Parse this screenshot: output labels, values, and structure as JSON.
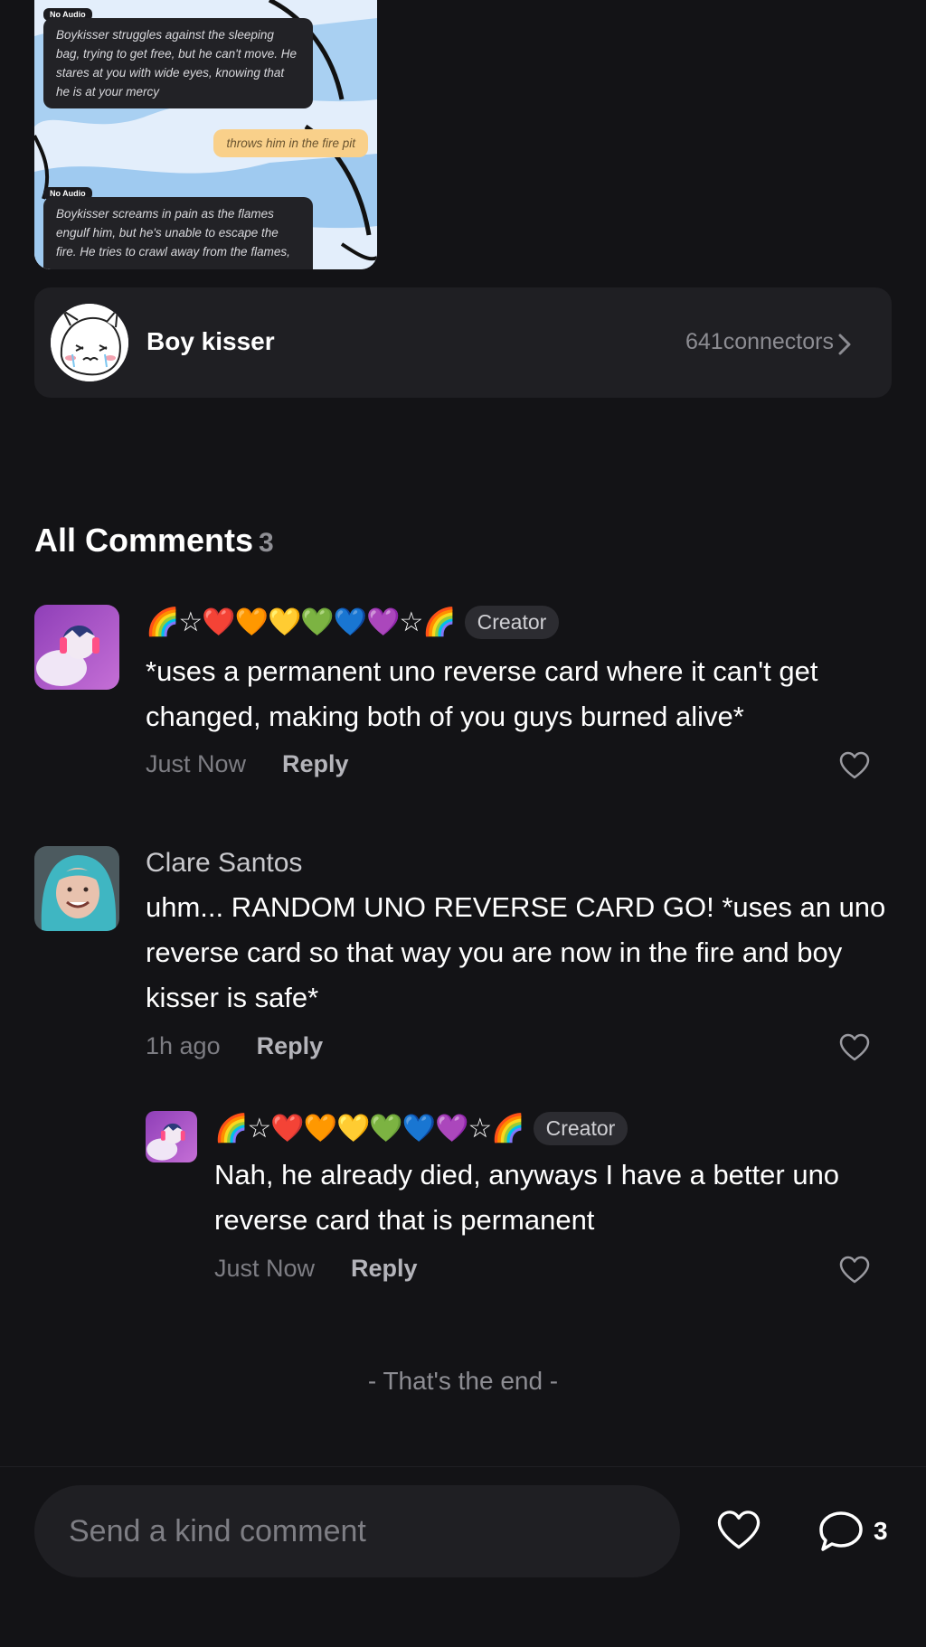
{
  "preview": {
    "messages": [
      {
        "tag": "No Audio",
        "text": "Boykisser struggles against the sleeping bag, trying to get free, but he can't move. He stares at you with wide eyes, knowing that he is at your mercy"
      },
      {
        "user_text": "throws him in the fire pit"
      },
      {
        "tag": "No Audio",
        "text": "Boykisser screams in pain as the flames engulf him, but he's unable to escape the fire. He tries to crawl away from the flames,"
      }
    ]
  },
  "character": {
    "name": "Boy kisser",
    "connectors": "641connectors"
  },
  "comments_section": {
    "title": "All Comments",
    "count": "3",
    "comments": [
      {
        "user": "🌈☆❤️🧡💛💚💙💜☆🌈",
        "badge": "Creator",
        "text": "*uses a permanent uno reverse card where it can't get changed, making both of you guys burned alive*",
        "time": "Just Now",
        "reply_label": "Reply"
      },
      {
        "user": "Clare Santos",
        "text": "uhm... RANDOM UNO REVERSE CARD GO! *uses an uno reverse card so that way you are now in the fire and boy kisser is safe*",
        "time": "1h ago",
        "reply_label": "Reply"
      },
      {
        "user": "🌈☆❤️🧡💛💚💙💜☆🌈",
        "badge": "Creator",
        "text": "Nah, he already died, anyways I have a better uno reverse card that is permanent",
        "time": "Just Now",
        "reply_label": "Reply"
      }
    ],
    "end_note": "- That's the end -"
  },
  "bottom_bar": {
    "placeholder": "Send a kind comment",
    "comment_count": "3"
  }
}
